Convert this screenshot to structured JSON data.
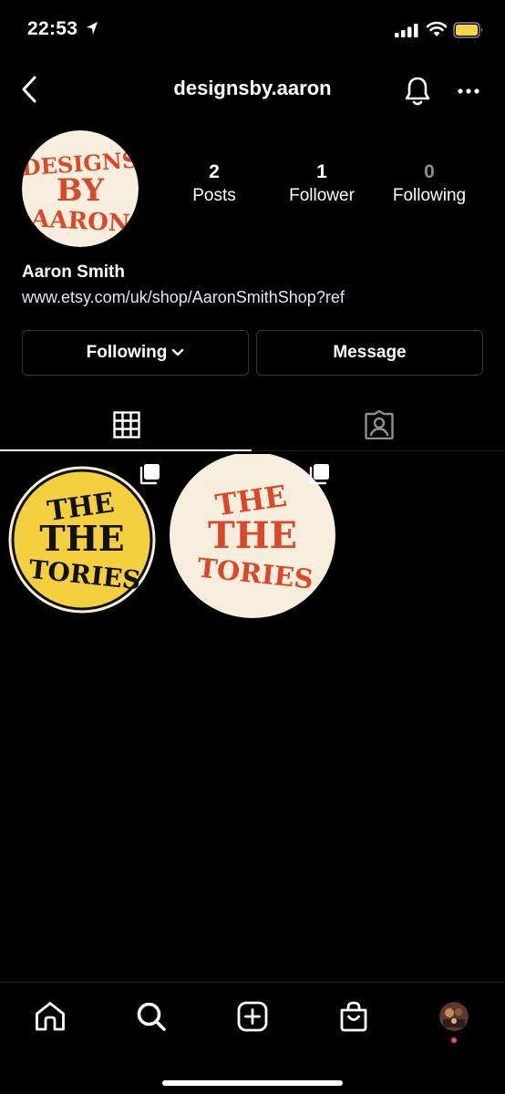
{
  "status_bar": {
    "time": "22:53"
  },
  "header": {
    "title": "designsby.aaron"
  },
  "avatar": {
    "logo_lines": [
      "DESIGNS",
      "BY",
      "AARON"
    ]
  },
  "stats": {
    "posts": {
      "value": "2",
      "label": "Posts"
    },
    "followers": {
      "value": "1",
      "label": "Follower"
    },
    "following": {
      "value": "0",
      "label": "Following"
    }
  },
  "bio": {
    "name": "Aaron Smith",
    "website": "www.etsy.com/uk/shop/AaronSmithShop?ref"
  },
  "actions": {
    "following_label": "Following",
    "message_label": "Message"
  },
  "tabs": [
    {
      "name": "grid",
      "icon": "grid-icon",
      "active": true
    },
    {
      "name": "tagged",
      "icon": "tagged-person-icon",
      "active": false
    }
  ],
  "posts": [
    {
      "artwork_lines": [
        "THE",
        "THE",
        "TORIES"
      ],
      "bg": "#f4d03f",
      "fg": "#111111",
      "multi": true
    },
    {
      "artwork_lines": [
        "THE",
        "THE",
        "TORIES"
      ],
      "bg": "#f7eede",
      "fg": "#d9482b",
      "multi": true
    }
  ],
  "bottom_nav": [
    "home-icon",
    "search-icon",
    "create-icon",
    "shop-icon",
    "profile-avatar"
  ],
  "colors": {
    "background": "#000000",
    "border": "#363636",
    "accent_red": "#d9482b",
    "accent_yellow": "#f4d03f",
    "notification": "#ed4956"
  }
}
